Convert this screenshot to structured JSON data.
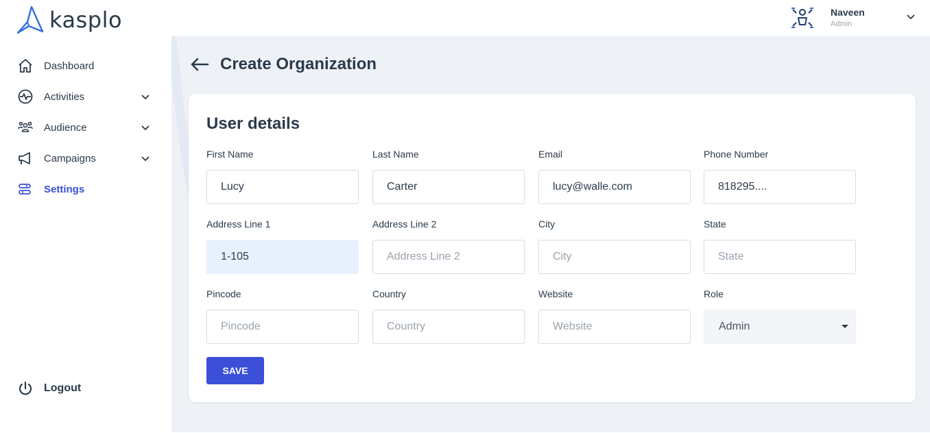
{
  "app": {
    "logo_text": "kasplo"
  },
  "user": {
    "name": "Naveen",
    "role": "Admin"
  },
  "sidebar": {
    "items": [
      {
        "label": "Dashboard",
        "icon": "home-icon",
        "has_submenu": false,
        "active": false
      },
      {
        "label": "Activities",
        "icon": "activity-icon",
        "has_submenu": true,
        "active": false
      },
      {
        "label": "Audience",
        "icon": "audience-icon",
        "has_submenu": true,
        "active": false
      },
      {
        "label": "Campaigns",
        "icon": "megaphone-icon",
        "has_submenu": true,
        "active": false
      },
      {
        "label": "Settings",
        "icon": "settings-sliders-icon",
        "has_submenu": false,
        "active": true
      }
    ],
    "logout_label": "Logout"
  },
  "page": {
    "title": "Create Organization",
    "section_title": "User details",
    "save_label": "SAVE"
  },
  "form": {
    "first_name": {
      "label": "First Name",
      "value": "Lucy",
      "placeholder": "First Name"
    },
    "last_name": {
      "label": "Last Name",
      "value": "Carter",
      "placeholder": "Last Name"
    },
    "email": {
      "label": "Email",
      "value": "lucy@walle.com",
      "placeholder": "Email"
    },
    "phone": {
      "label": "Phone Number",
      "value": "818295....",
      "placeholder": "Phone Number"
    },
    "address1": {
      "label": "Address Line 1",
      "value": "1-105",
      "placeholder": "Address Line 1"
    },
    "address2": {
      "label": "Address Line 2",
      "value": "",
      "placeholder": "Address Line 2"
    },
    "city": {
      "label": "City",
      "value": "",
      "placeholder": "City"
    },
    "state": {
      "label": "State",
      "value": "",
      "placeholder": "State"
    },
    "pincode": {
      "label": "Pincode",
      "value": "",
      "placeholder": "Pincode"
    },
    "country": {
      "label": "Country",
      "value": "",
      "placeholder": "Country"
    },
    "website": {
      "label": "Website",
      "value": "",
      "placeholder": "Website"
    },
    "role": {
      "label": "Role",
      "selected": "Admin"
    }
  },
  "colors": {
    "accent": "#3b4fd8",
    "background": "#eef2f7",
    "text": "#2b3a4a",
    "logo_mark": "#2f6fe0"
  }
}
